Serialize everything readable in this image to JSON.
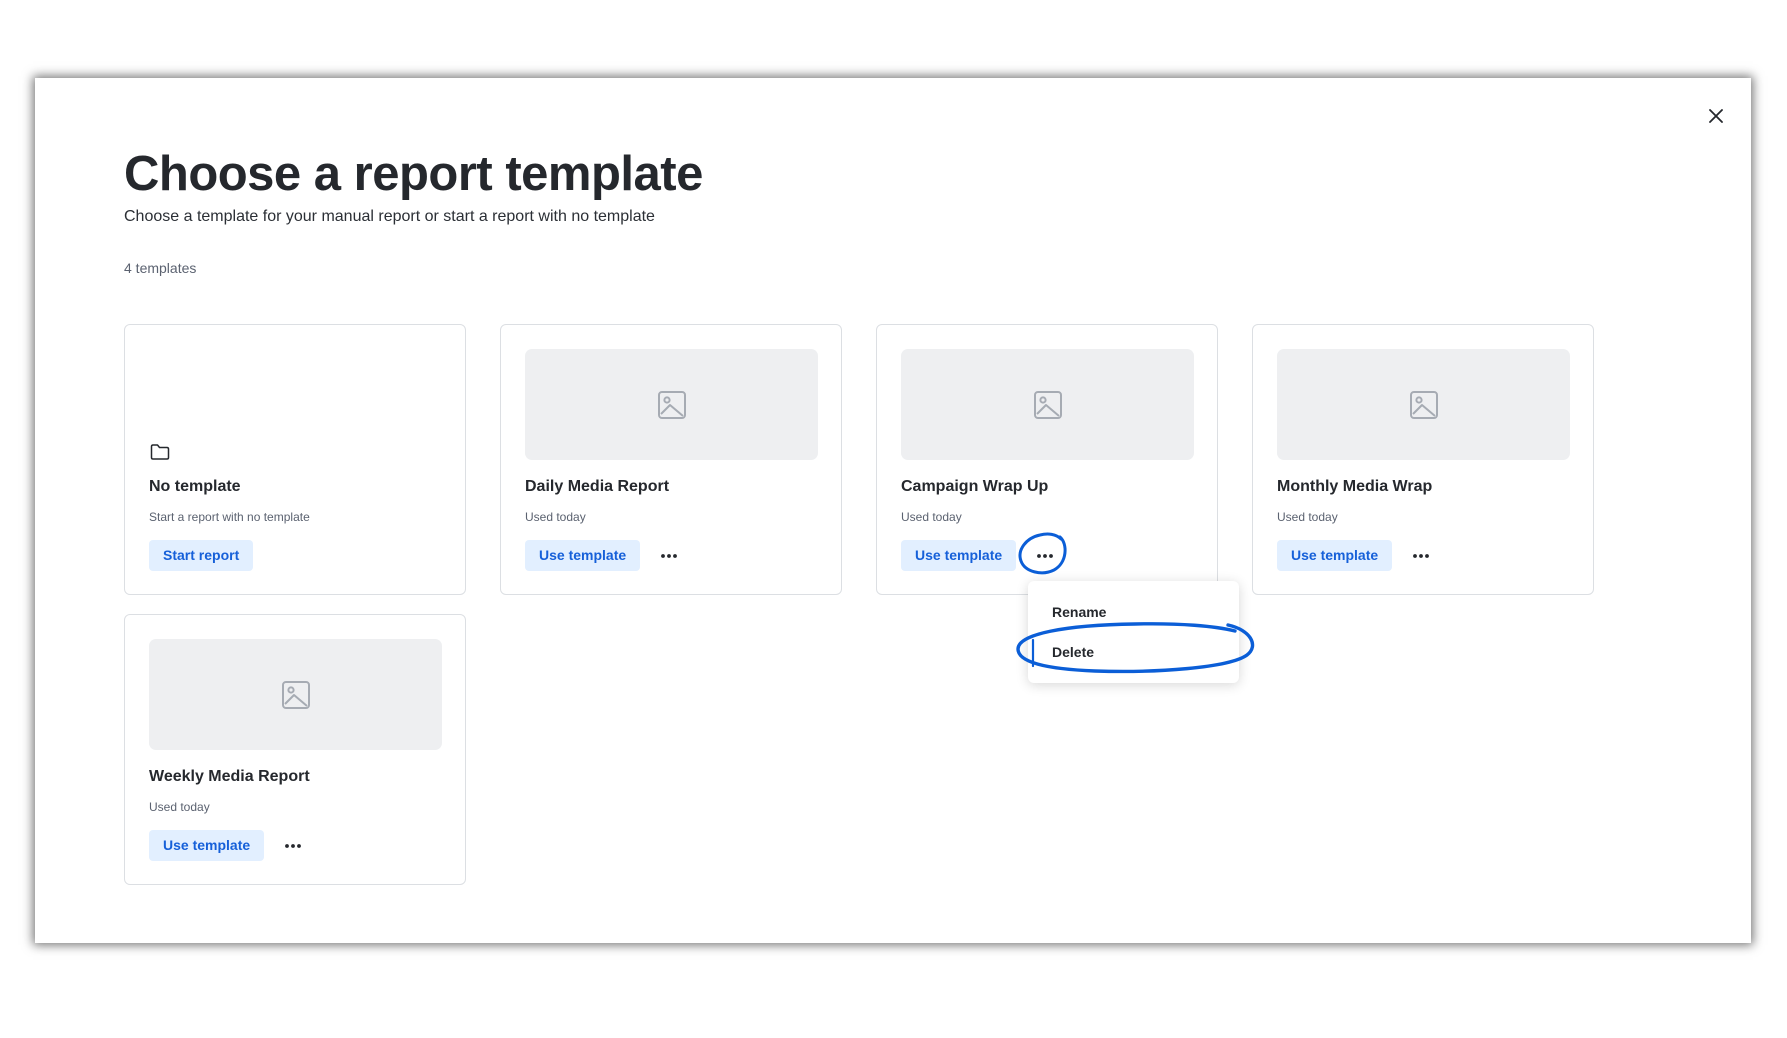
{
  "modal": {
    "title": "Choose a report template",
    "subtitle": "Choose a template for your manual report or start a report with no template",
    "count_label": "4 templates"
  },
  "cards": [
    {
      "title": "No template",
      "subtitle": "Start a report with no template",
      "button": "Start report"
    },
    {
      "title": "Daily Media Report",
      "subtitle": "Used today",
      "button": "Use template",
      "more": "•••"
    },
    {
      "title": "Campaign Wrap Up",
      "subtitle": "Used today",
      "button": "Use template",
      "more": "•••"
    },
    {
      "title": "Monthly Media Wrap",
      "subtitle": "Used today",
      "button": "Use template",
      "more": "•••"
    },
    {
      "title": "Weekly Media Report",
      "subtitle": "Used today",
      "button": "Use template",
      "more": "•••"
    }
  ],
  "menu": {
    "items": [
      "Rename",
      "Delete"
    ]
  },
  "colors": {
    "accent": "#1660d9",
    "button_bg": "#e2efff",
    "annotation": "#0b5ed7",
    "thumb_bg": "#eeeff1"
  },
  "icons": {
    "close": "close-icon",
    "folder": "folder-icon",
    "image": "image-placeholder-icon",
    "more": "more-horizontal-icon"
  }
}
